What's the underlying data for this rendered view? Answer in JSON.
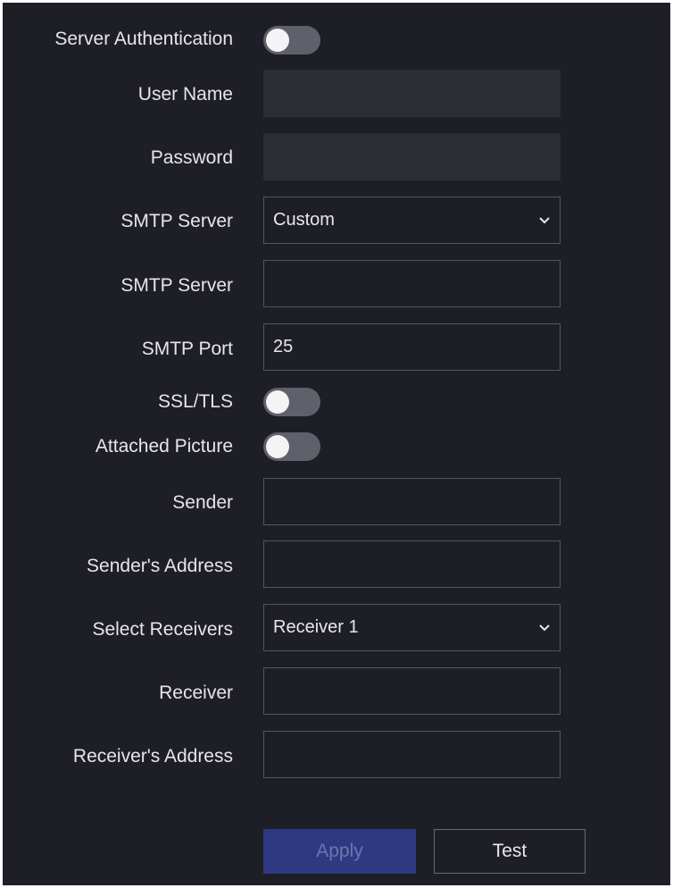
{
  "form": {
    "server_auth_label": "Server Authentication",
    "user_name_label": "User Name",
    "password_label": "Password",
    "smtp_server_select_label": "SMTP Server",
    "smtp_server_select_value": "Custom",
    "smtp_server_label": "SMTP Server",
    "smtp_server_value": "",
    "smtp_port_label": "SMTP Port",
    "smtp_port_value": "25",
    "ssl_tls_label": "SSL/TLS",
    "attached_picture_label": "Attached Picture",
    "sender_label": "Sender",
    "sender_value": "",
    "sender_address_label": "Sender's Address",
    "sender_address_value": "",
    "select_receivers_label": "Select Receivers",
    "select_receivers_value": "Receiver 1",
    "receiver_label": "Receiver",
    "receiver_value": "",
    "receiver_address_label": "Receiver's Address",
    "receiver_address_value": ""
  },
  "toggles": {
    "server_auth_on": false,
    "ssl_tls_on": false,
    "attached_picture_on": false
  },
  "buttons": {
    "apply_label": "Apply",
    "test_label": "Test"
  },
  "icons": {
    "dropdown": "chevron-down-icon"
  },
  "colors": {
    "background": "#1e1f26",
    "apply_button": "#2d3a82",
    "toggle_off": "#5f6069"
  }
}
